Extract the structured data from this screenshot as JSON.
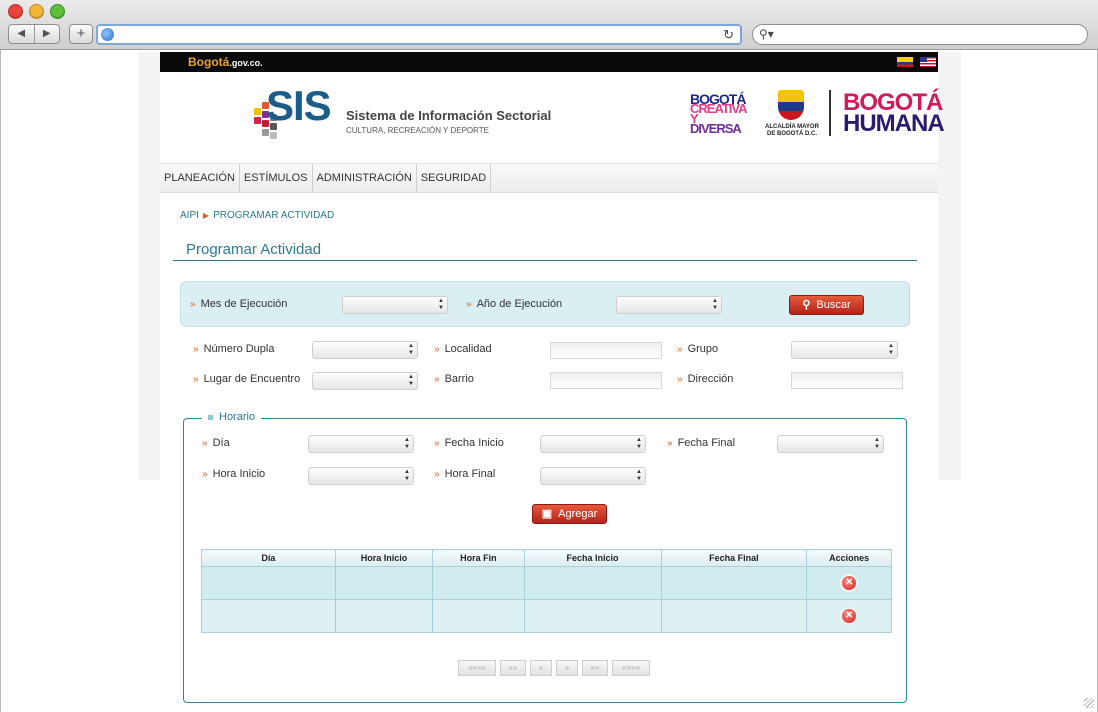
{
  "browser": {
    "url": "",
    "search_placeholder": ""
  },
  "site": {
    "brand_small": "Bogotá",
    "brand_small_suffix": ".gov.co.",
    "sis_abbr": "SIS",
    "sis_title": "Sistema de Información Sectorial",
    "sis_subtitle": "CULTURA, RECREACIÓN Y DEPORTE",
    "logo_creativa": [
      "BOGOTÁ",
      "CREATIVA Y",
      "DIVERSA"
    ],
    "alcaldia": "ALCALDÍA MAYOR DE BOGOTÁ D.C.",
    "logo_humana": [
      "BOGOTÁ",
      "HUMANA"
    ]
  },
  "menu": [
    "PLANEACIÓN",
    "ESTÍMULOS",
    "ADMINISTRACIÓN",
    "SEGURIDAD"
  ],
  "breadcrumb": {
    "root": "AIPI",
    "current": "PROGRAMAR ACTIVIDAD"
  },
  "page_title": "Programar Actividad",
  "search": {
    "mes_label": "Mes de Ejecución",
    "anio_label": "Año de Ejecución",
    "buscar_label": "Buscar"
  },
  "filters": {
    "numero_dupla": "Número Dupla",
    "localidad": "Localidad",
    "grupo": "Grupo",
    "lugar_encuentro": "Lugar de Encuentro",
    "barrio": "Barrio",
    "direccion": "Dirección"
  },
  "horario": {
    "legend": "Horario",
    "dia": "Día",
    "fecha_inicio": "Fecha Inicio",
    "fecha_final": "Fecha Final",
    "hora_inicio": "Hora Inicio",
    "hora_final": "Hora Final",
    "agregar_label": "Agregar"
  },
  "table": {
    "headers": [
      "Día",
      "Hora Inicio",
      "Hora Fin",
      "Fecha Inicio",
      "Fecha Final",
      "Acciones"
    ],
    "rows": [
      [
        "",
        "",
        "",
        "",
        ""
      ],
      [
        "",
        "",
        "",
        "",
        ""
      ]
    ]
  },
  "pager": [
    "««««",
    "««",
    "«",
    "»",
    "»»",
    "»»»»"
  ],
  "colors": {
    "accent_teal": "#2b7a8f",
    "button_red": "#c0321f",
    "panel_bg": "#daeff2"
  }
}
